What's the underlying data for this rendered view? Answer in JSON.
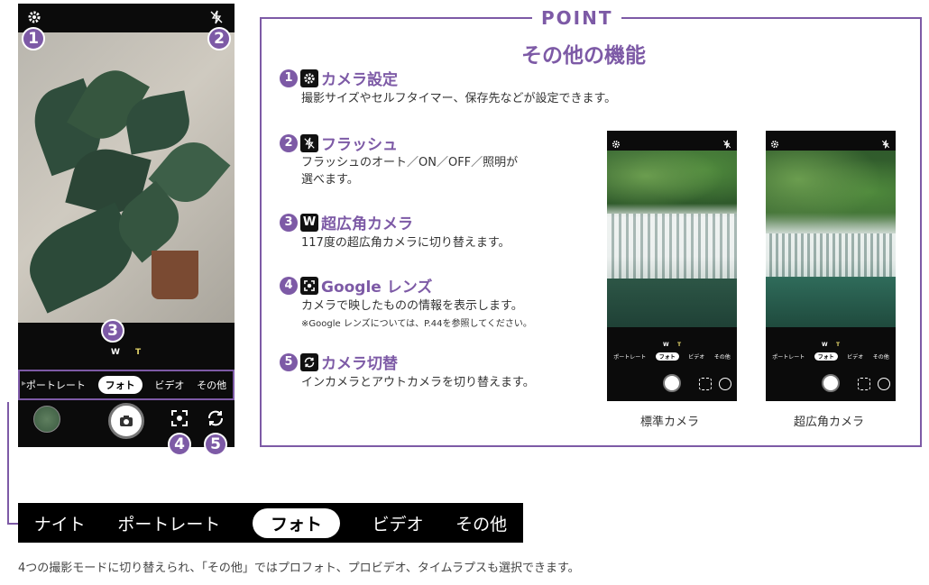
{
  "phone": {
    "zoom_w": "W",
    "zoom_t": "T",
    "modes": [
      "ポートレート",
      "フォト",
      "ビデオ",
      "その他"
    ],
    "selected_mode": "フォト",
    "badges": [
      "1",
      "2",
      "3",
      "4",
      "5"
    ]
  },
  "mode_strip": {
    "modes": [
      "ナイト",
      "ポートレート",
      "フォト",
      "ビデオ",
      "その他"
    ],
    "selected": "フォト"
  },
  "caption": "4つの撮影モードに切り替えられ、「その他」ではプロフォト、プロビデオ、タイムラプスも選択できます。",
  "point": {
    "title": "POINT",
    "subtitle": "その他の機能",
    "items": [
      {
        "num": "1",
        "icon": "gear-icon",
        "title": "カメラ設定",
        "desc": [
          "撮影サイズやセルフタイマー、保存先などが設定できます。"
        ]
      },
      {
        "num": "2",
        "icon": "flash-off-icon",
        "title": "フラッシュ",
        "desc": [
          "フラッシュのオート／ON／OFF／照明が",
          "選べます。"
        ]
      },
      {
        "num": "3",
        "icon": "wide-angle-icon",
        "icon_text": "W",
        "title": "超広角カメラ",
        "desc": [
          "117度の超広角カメラに切り替えます。"
        ]
      },
      {
        "num": "4",
        "icon": "google-lens-icon",
        "title": "Google レンズ",
        "desc": [
          "カメラで映したものの情報を表示します。"
        ],
        "note": "※Google レンズについては、P.44を参照してください。"
      },
      {
        "num": "5",
        "icon": "camera-switch-icon",
        "title": "カメラ切替",
        "desc": [
          "インカメラとアウトカメラを切り替えます。"
        ]
      }
    ],
    "examples": [
      {
        "label": "標準カメラ",
        "modes": [
          "ポートレート",
          "フォト",
          "ビデオ",
          "その他"
        ],
        "selected": "フォト",
        "w": "W",
        "t": "T"
      },
      {
        "label": "超広角カメラ",
        "modes": [
          "ポートレート",
          "フォト",
          "ビデオ",
          "その他"
        ],
        "selected": "フォト",
        "w": "W",
        "t": "T"
      }
    ]
  },
  "colors": {
    "accent": "#7d5aa6",
    "phone_bg": "#0b0b0b"
  }
}
